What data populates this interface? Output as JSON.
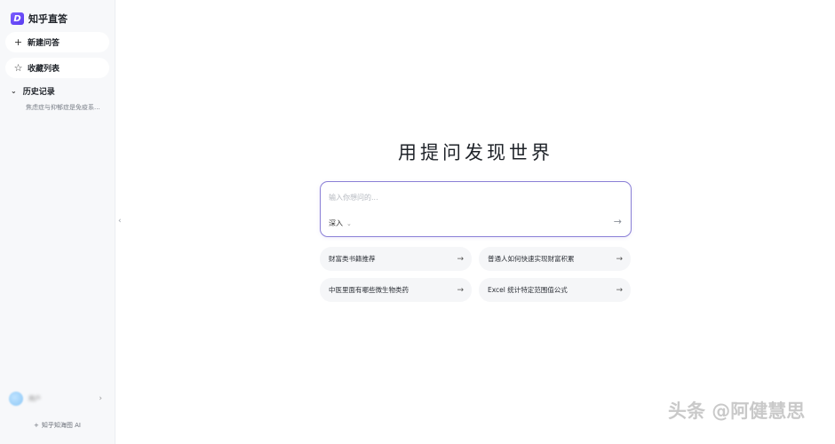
{
  "app": {
    "logo_glyph": "D",
    "name": "知乎直答",
    "brand_color": "#6a4cf5"
  },
  "sidebar": {
    "new_chat": {
      "icon": "plus-icon",
      "glyph": "+",
      "label": "新建问答"
    },
    "favorites": {
      "icon": "star-icon",
      "glyph": "☆",
      "label": "收藏列表"
    },
    "history": {
      "icon": "chevron-down-icon",
      "glyph": "⌄",
      "label": "历史记录",
      "items": [
        "焦虑症与抑郁症是免疫系..."
      ]
    },
    "user": {
      "name": "用户",
      "chevron": "›"
    },
    "footer": {
      "glyph": "+",
      "label": "知乎知海图 AI"
    },
    "collapse_glyph": "‹"
  },
  "main": {
    "title": "用提问发现世界",
    "input": {
      "placeholder": "输入你想问的...",
      "value": "",
      "mode_label": "深入",
      "mode_chevron": "⌄",
      "send_glyph": "→"
    },
    "suggestions": [
      {
        "text": "财富类书籍推荐",
        "arrow": "→"
      },
      {
        "text": "普通人如何快速实现财富积累",
        "arrow": "→"
      },
      {
        "text": "中医里面有哪些微生物类药",
        "arrow": "→"
      },
      {
        "text": "Excel 统计特定范围值公式",
        "arrow": "→"
      }
    ]
  },
  "watermark": "头条 @阿健慧思"
}
